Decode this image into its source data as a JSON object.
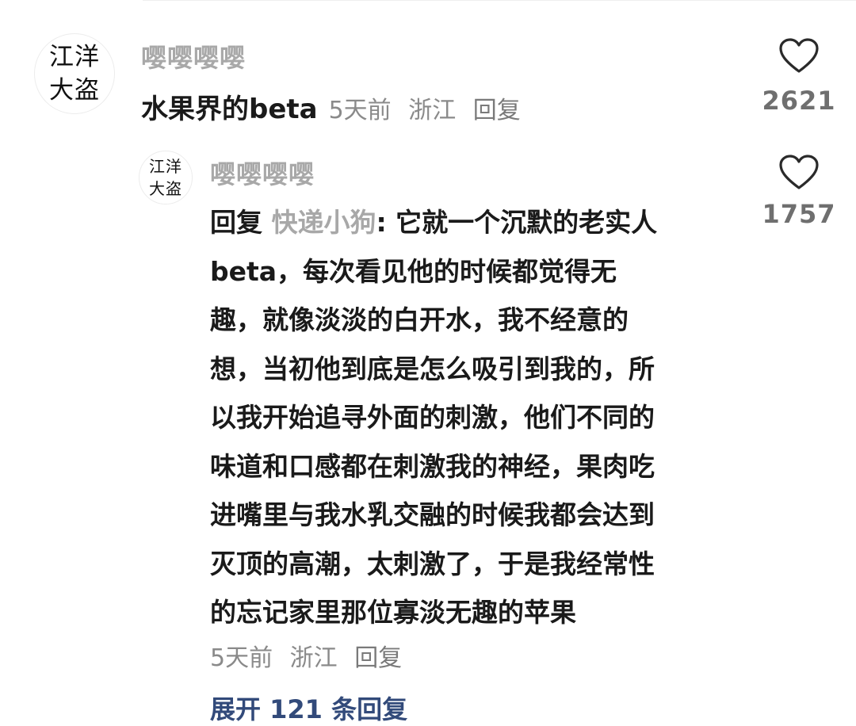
{
  "comment": {
    "avatar_text": "江洋\n大盗",
    "username": "嘤嘤嘤嘤",
    "text": "水果界的beta",
    "time": "5天前",
    "location": "浙江",
    "reply_label": "回复",
    "likes": "2621"
  },
  "reply": {
    "avatar_text": "江洋\n大盗",
    "username": "嘤嘤嘤嘤",
    "prefix": "回复 ",
    "reply_to": "快递小狗",
    "lines": [
      ": 它就一个沉默的老实人",
      "beta，每次看见他的时候都觉得无",
      "趣，就像淡淡的白开水，我不经意的",
      "想，当初他到底是怎么吸引到我的，所",
      "以我开始追寻外面的刺激，他们不同的",
      "味道和口感都在刺激我的神经，果肉吃",
      "进嘴里与我水乳交融的时候我都会达到",
      "灭顶的高潮，太刺激了，于是我经常性",
      "的忘记家里那位寡淡无趣的苹果"
    ],
    "time": "5天前",
    "location": "浙江",
    "reply_label": "回复",
    "likes": "1757"
  },
  "expand_label": "展开 121 条回复"
}
